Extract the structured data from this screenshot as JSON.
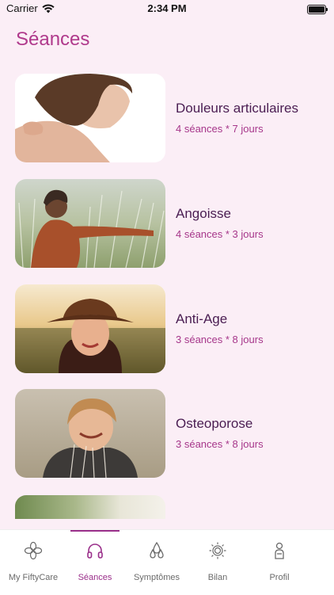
{
  "status": {
    "carrier": "Carrier",
    "time": "2:34 PM"
  },
  "page": {
    "title": "Séances"
  },
  "seances": [
    {
      "title": "Douleurs articulaires",
      "subtitle": "4 séances * 7 jours",
      "image": "woman-shoulder-photo"
    },
    {
      "title": "Angoisse",
      "subtitle": "4 séances * 3 jours",
      "image": "woman-field-photo"
    },
    {
      "title": "Anti-Age",
      "subtitle": "3 séances * 8 jours",
      "image": "woman-hat-photo"
    },
    {
      "title": "Osteoporose",
      "subtitle": "3 séances * 8 jours",
      "image": "woman-laughing-photo"
    }
  ],
  "tabs": [
    {
      "label": "My FiftyCare",
      "icon": "flower-icon",
      "active": false
    },
    {
      "label": "Séances",
      "icon": "headphones-icon",
      "active": true
    },
    {
      "label": "Symptômes",
      "icon": "drops-icon",
      "active": false
    },
    {
      "label": "Bilan",
      "icon": "sun-icon",
      "active": false
    },
    {
      "label": "Profil",
      "icon": "profile-icon",
      "active": false
    }
  ],
  "colors": {
    "accent": "#9a2f8a",
    "title": "#b03a8c",
    "background": "#fbeef6"
  }
}
